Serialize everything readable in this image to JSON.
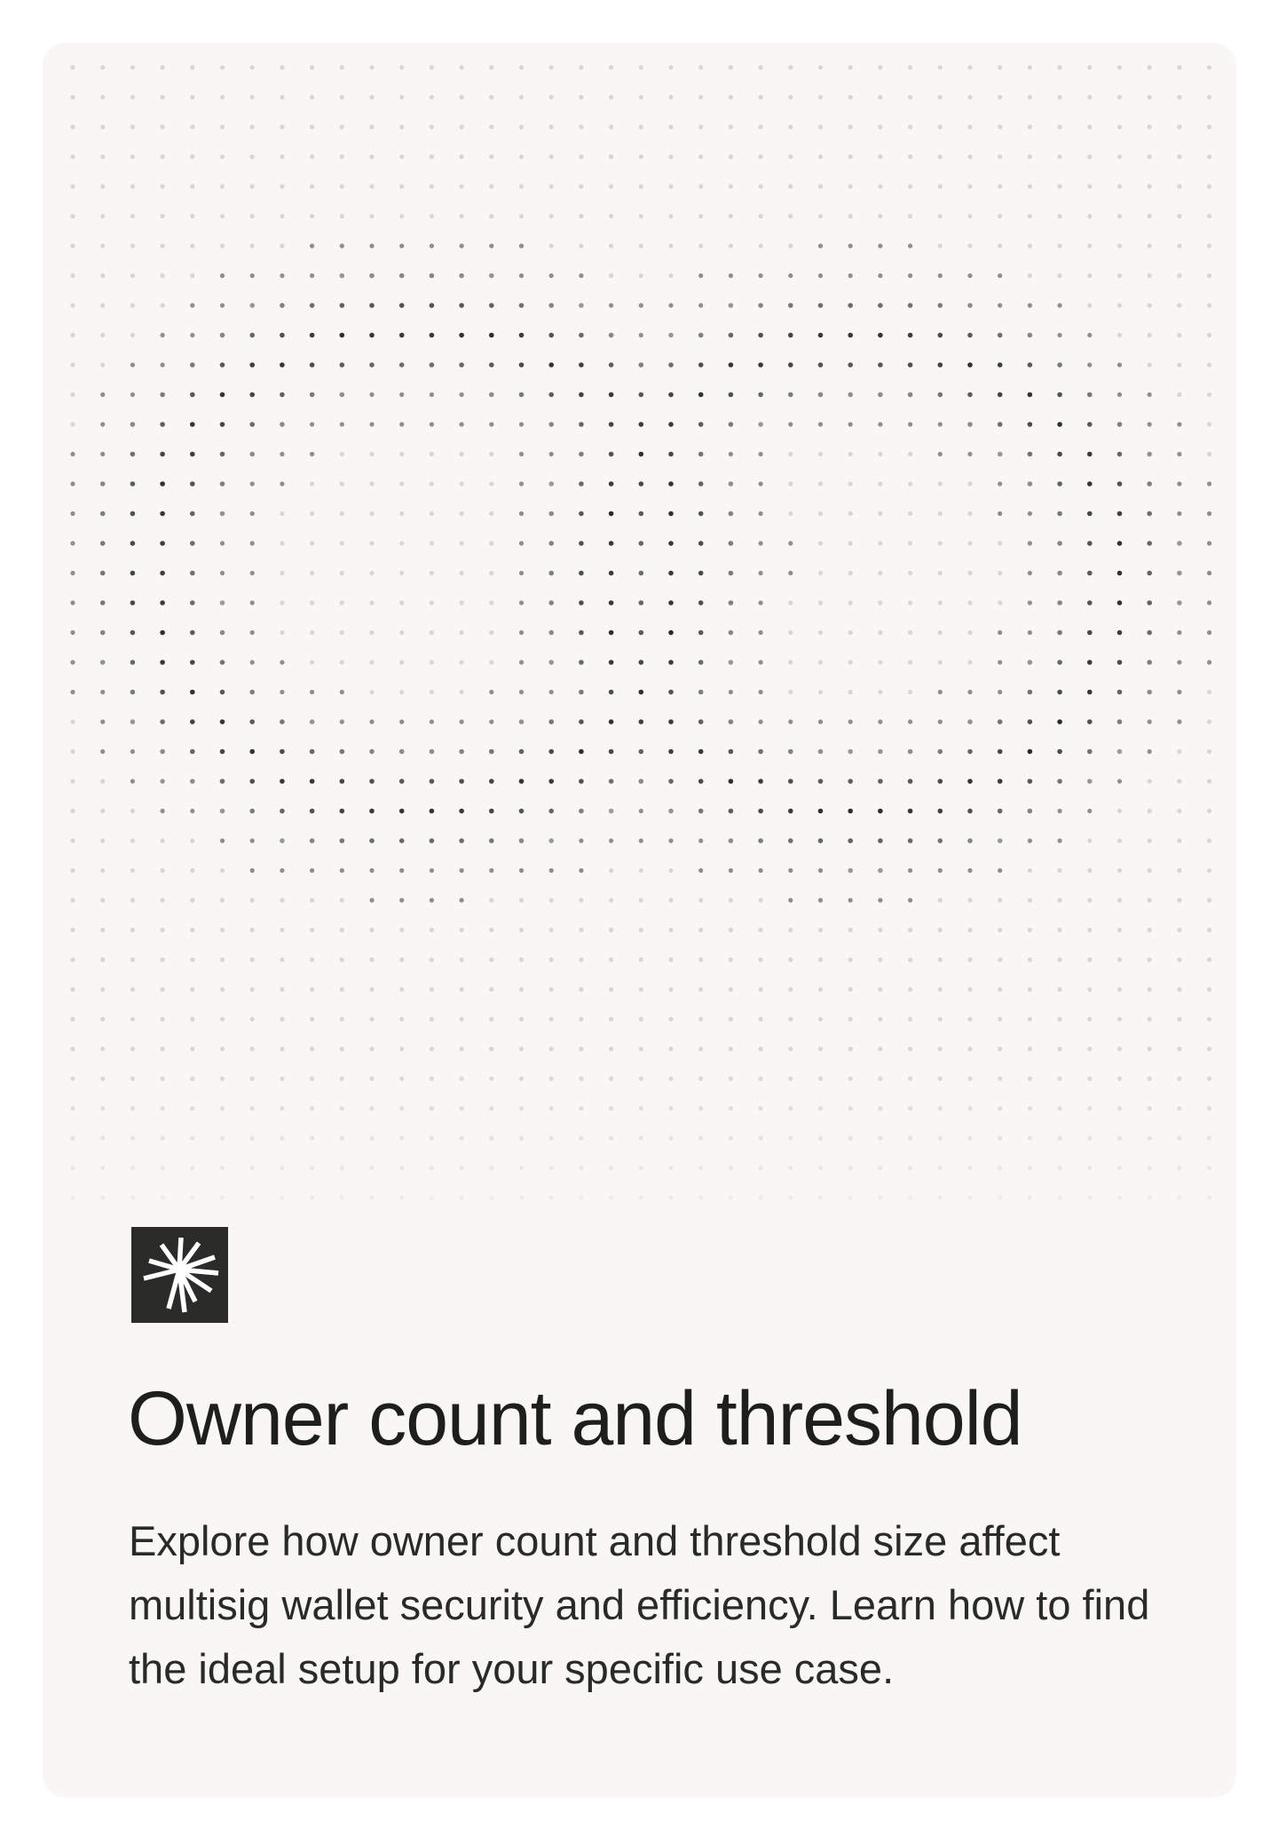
{
  "card": {
    "title": "Owner count and threshold",
    "description": "Explore how owner count and threshold size affect multisig wallet security and efficiency. Learn how to find the ideal setup for your specific use case.",
    "logo_icon": "starburst-icon",
    "illustration": "dot-pattern-icon"
  },
  "colors": {
    "card_background": "#f8f7f3",
    "dot_light": "#d4d2cc",
    "dot_dark": "#2a2a28",
    "logo_background": "#2b2b2a",
    "text": "#1e1e1c"
  }
}
